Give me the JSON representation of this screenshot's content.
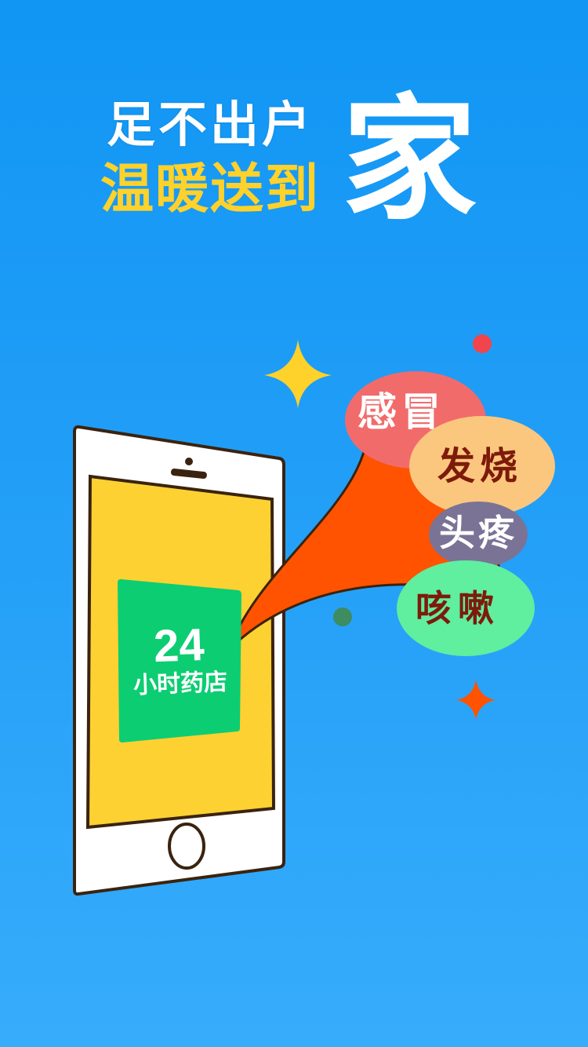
{
  "headline": {
    "line1": "足不出户",
    "line2": "温暖送到",
    "big_char": "家"
  },
  "badge": {
    "number": "24",
    "label": "小时药店"
  },
  "bubbles": [
    {
      "text": "感冒",
      "color": "#f26b6b",
      "text_color": "#ffffff"
    },
    {
      "text": "发烧",
      "color": "#fbc77e",
      "text_color": "#7d1b0b"
    },
    {
      "text": "头疼",
      "color": "#7a7396",
      "text_color": "#ffffff"
    },
    {
      "text": "咳嗽",
      "color": "#60ee9f",
      "text_color": "#7d1b0b"
    }
  ],
  "colors": {
    "background_top": "#1196f4",
    "background_bottom": "#37acfb",
    "phone_screen": "#fdd132",
    "badge_green": "#0ccd72",
    "cone_orange": "#ff5301",
    "accent_yellow": "#ffd12b"
  },
  "icons": [
    "sparkle-star-icon",
    "orange-star-icon",
    "phone-home-button-icon"
  ]
}
